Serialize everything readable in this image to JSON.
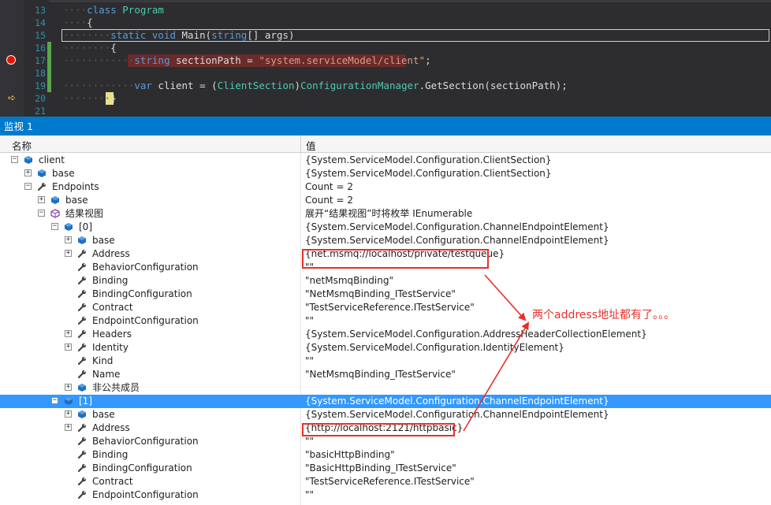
{
  "editor": {
    "lines": [
      {
        "num": "13",
        "indent": "····",
        "code": [
          {
            "t": "class ",
            "c": "kw"
          },
          {
            "t": "Program",
            "c": "ty"
          }
        ]
      },
      {
        "num": "14",
        "indent": "····",
        "code": [
          {
            "t": "{",
            "c": ""
          }
        ]
      },
      {
        "num": "15",
        "indent": "········",
        "code": [
          {
            "t": "static void ",
            "c": "kw"
          },
          {
            "t": "Main(",
            "c": ""
          },
          {
            "t": "string",
            "c": "kw"
          },
          {
            "t": "[] args)",
            "c": ""
          }
        ]
      },
      {
        "num": "16",
        "indent": "········",
        "code": [
          {
            "t": "{",
            "c": ""
          }
        ]
      },
      {
        "num": "17",
        "indent": "············",
        "code": [
          {
            "t": "string ",
            "c": "kw"
          },
          {
            "t": "sectionPath = ",
            "c": ""
          },
          {
            "t": "\"system.serviceModel/client\"",
            "c": "st"
          },
          {
            "t": ";",
            "c": ""
          }
        ]
      },
      {
        "num": "18",
        "indent": "",
        "code": []
      },
      {
        "num": "19",
        "indent": "············",
        "code": [
          {
            "t": "var ",
            "c": "kw"
          },
          {
            "t": "client = (",
            "c": ""
          },
          {
            "t": "ClientSection",
            "c": "ty"
          },
          {
            "t": ")",
            "c": ""
          },
          {
            "t": "ConfigurationManager",
            "c": "ty"
          },
          {
            "t": ".GetSection(sectionPath);",
            "c": ""
          }
        ]
      },
      {
        "num": "20",
        "indent": "········",
        "code": [
          {
            "t": "}",
            "c": ""
          }
        ]
      },
      {
        "num": "21",
        "indent": "",
        "code": []
      }
    ]
  },
  "watch": {
    "title": "监视 1",
    "col_name": "名称",
    "col_value": "值",
    "rows": [
      {
        "name": "client",
        "value": "{System.ServiceModel.Configuration.ClientSection}",
        "level": 0,
        "exp": "−",
        "icon": "object-icon"
      },
      {
        "name": "base",
        "value": "{System.ServiceModel.Configuration.ClientSection}",
        "level": 1,
        "exp": "+",
        "icon": "object-icon"
      },
      {
        "name": "Endpoints",
        "value": "Count = 2",
        "level": 1,
        "exp": "−",
        "icon": "property-wrench-icon"
      },
      {
        "name": "base",
        "value": "Count = 2",
        "level": 2,
        "exp": "+",
        "icon": "object-icon"
      },
      {
        "name": "结果视图",
        "value": "展开“结果视图”时将枚举 IEnumerable",
        "level": 2,
        "exp": "−",
        "icon": "results-view-icon"
      },
      {
        "name": "[0]",
        "value": "{System.ServiceModel.Configuration.ChannelEndpointElement}",
        "level": 3,
        "exp": "−",
        "icon": "object-icon"
      },
      {
        "name": "base",
        "value": "{System.ServiceModel.Configuration.ChannelEndpointElement}",
        "level": 4,
        "exp": "+",
        "icon": "object-icon"
      },
      {
        "name": "Address",
        "value": "{net.msmq://localhost/private/testqueue}",
        "level": 4,
        "exp": "+",
        "icon": "property-wrench-icon"
      },
      {
        "name": "BehaviorConfiguration",
        "value": "\"\"",
        "level": 4,
        "exp": "",
        "icon": "property-wrench-icon"
      },
      {
        "name": "Binding",
        "value": "\"netMsmqBinding\"",
        "level": 4,
        "exp": "",
        "icon": "property-wrench-icon"
      },
      {
        "name": "BindingConfiguration",
        "value": "\"NetMsmqBinding_ITestService\"",
        "level": 4,
        "exp": "",
        "icon": "property-wrench-icon"
      },
      {
        "name": "Contract",
        "value": "\"TestServiceReference.ITestService\"",
        "level": 4,
        "exp": "",
        "icon": "property-wrench-icon"
      },
      {
        "name": "EndpointConfiguration",
        "value": "\"\"",
        "level": 4,
        "exp": "",
        "icon": "property-wrench-icon"
      },
      {
        "name": "Headers",
        "value": "{System.ServiceModel.Configuration.AddressHeaderCollectionElement}",
        "level": 4,
        "exp": "+",
        "icon": "property-wrench-icon"
      },
      {
        "name": "Identity",
        "value": "{System.ServiceModel.Configuration.IdentityElement}",
        "level": 4,
        "exp": "+",
        "icon": "property-wrench-icon"
      },
      {
        "name": "Kind",
        "value": "\"\"",
        "level": 4,
        "exp": "",
        "icon": "property-wrench-icon"
      },
      {
        "name": "Name",
        "value": "\"NetMsmqBinding_ITestService\"",
        "level": 4,
        "exp": "",
        "icon": "property-wrench-icon"
      },
      {
        "name": "非公共成员",
        "value": "",
        "level": 4,
        "exp": "+",
        "icon": "object-icon"
      },
      {
        "name": "[1]",
        "value": "{System.ServiceModel.Configuration.ChannelEndpointElement}",
        "level": 3,
        "exp": "−",
        "icon": "object-icon",
        "selected": true
      },
      {
        "name": "base",
        "value": "{System.ServiceModel.Configuration.ChannelEndpointElement}",
        "level": 4,
        "exp": "+",
        "icon": "object-icon"
      },
      {
        "name": "Address",
        "value": "{http://localhost:2121/httpbasic}",
        "level": 4,
        "exp": "+",
        "icon": "property-wrench-icon"
      },
      {
        "name": "BehaviorConfiguration",
        "value": "\"\"",
        "level": 4,
        "exp": "",
        "icon": "property-wrench-icon"
      },
      {
        "name": "Binding",
        "value": "\"basicHttpBinding\"",
        "level": 4,
        "exp": "",
        "icon": "property-wrench-icon"
      },
      {
        "name": "BindingConfiguration",
        "value": "\"BasicHttpBinding_ITestService\"",
        "level": 4,
        "exp": "",
        "icon": "property-wrench-icon"
      },
      {
        "name": "Contract",
        "value": "\"TestServiceReference.ITestService\"",
        "level": 4,
        "exp": "",
        "icon": "property-wrench-icon"
      },
      {
        "name": "EndpointConfiguration",
        "value": "\"\"",
        "level": 4,
        "exp": "",
        "icon": "property-wrench-icon"
      }
    ]
  },
  "annotation": {
    "text": "两个address地址都有了。。。",
    "color": "#e8302a"
  },
  "colors": {
    "accent": "#007acc",
    "selection": "#3399ff",
    "breakpoint": "#e51400",
    "annotation": "#e8302a"
  }
}
